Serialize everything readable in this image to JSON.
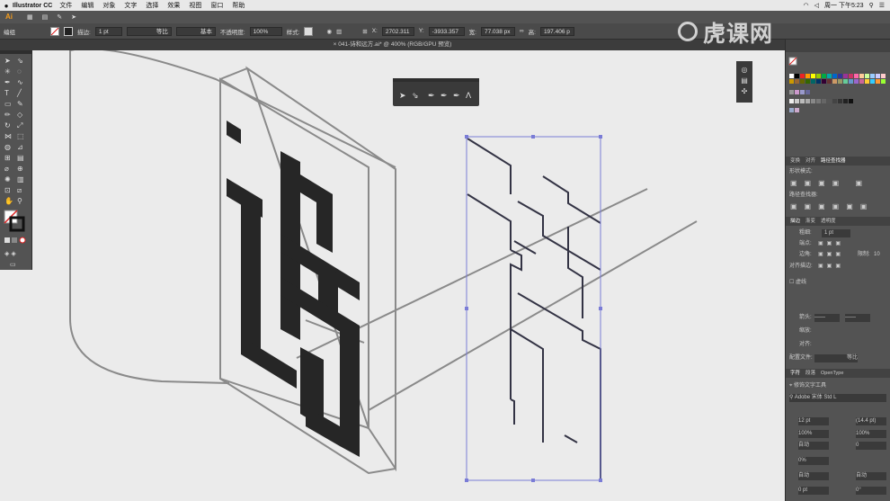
{
  "menubar": {
    "apple": "",
    "app_name": "Illustrator CC",
    "menus": [
      "文件",
      "编辑",
      "对象",
      "文字",
      "选择",
      "效果",
      "视图",
      "窗口",
      "帮助"
    ],
    "clock": "周一 下午5:23"
  },
  "app_logo": "Ai",
  "control_bar": {
    "mode_label": "编组",
    "stroke_label": "描边:",
    "stroke_value": "1 pt",
    "profile_label": "等比",
    "brush_label": "基本",
    "opacity_label": "不透明度:",
    "opacity_value": "100%",
    "style_label": "样式:",
    "x_value": "2702.311",
    "y_value": "-3933.357",
    "w_value": "77.038 px",
    "h_value": "197.406 p"
  },
  "document_tab": "041-诗和远方.ai* @ 400% (RGB/GPU 预览)",
  "watermark": "虎课网",
  "right_panel": {
    "pathfinder_tabs": [
      "变换",
      "对齐",
      "路径查找器"
    ],
    "shape_modes_label": "形状模式:",
    "pathfinder_label": "路径查找器:",
    "stroke_tabs": [
      "描边",
      "渐变",
      "透明度"
    ],
    "weight_label": "粗细:",
    "weight_value": "1 pt",
    "cap_label": "端点:",
    "corner_label": "边角:",
    "limit_label": "限制:",
    "limit_value": "10",
    "align_label": "对齐描边:",
    "dashed_label": "虚线",
    "arrow_label": "箭头:",
    "scale_label": "缩放:",
    "align2_label": "对齐:",
    "profile_label": "配置文件:",
    "profile_value": "等比",
    "char_tabs": [
      "字符",
      "段落",
      "OpenType"
    ],
    "touch_type_label": "修饰文字工具",
    "font_value": "Adobe 宋体 Std L",
    "font_size": "12 pt",
    "leading": "(14.4 pt)",
    "scale_h": "100%",
    "scale_v": "100%",
    "kerning": "自动",
    "tracking": "0",
    "tsume": "0%",
    "aki_left": "自动",
    "aki_right": "自动",
    "baseline": "0 pt",
    "rotation": "0°"
  },
  "colors": {
    "ui_dark": "#535353",
    "canvas": "#ebebeb",
    "glyph_fill": "#262626",
    "path_line": "#333344",
    "guide_grey": "#8a8a8a",
    "selection_blue": "#7a7cd6",
    "ai_orange": "#f29b1d"
  }
}
